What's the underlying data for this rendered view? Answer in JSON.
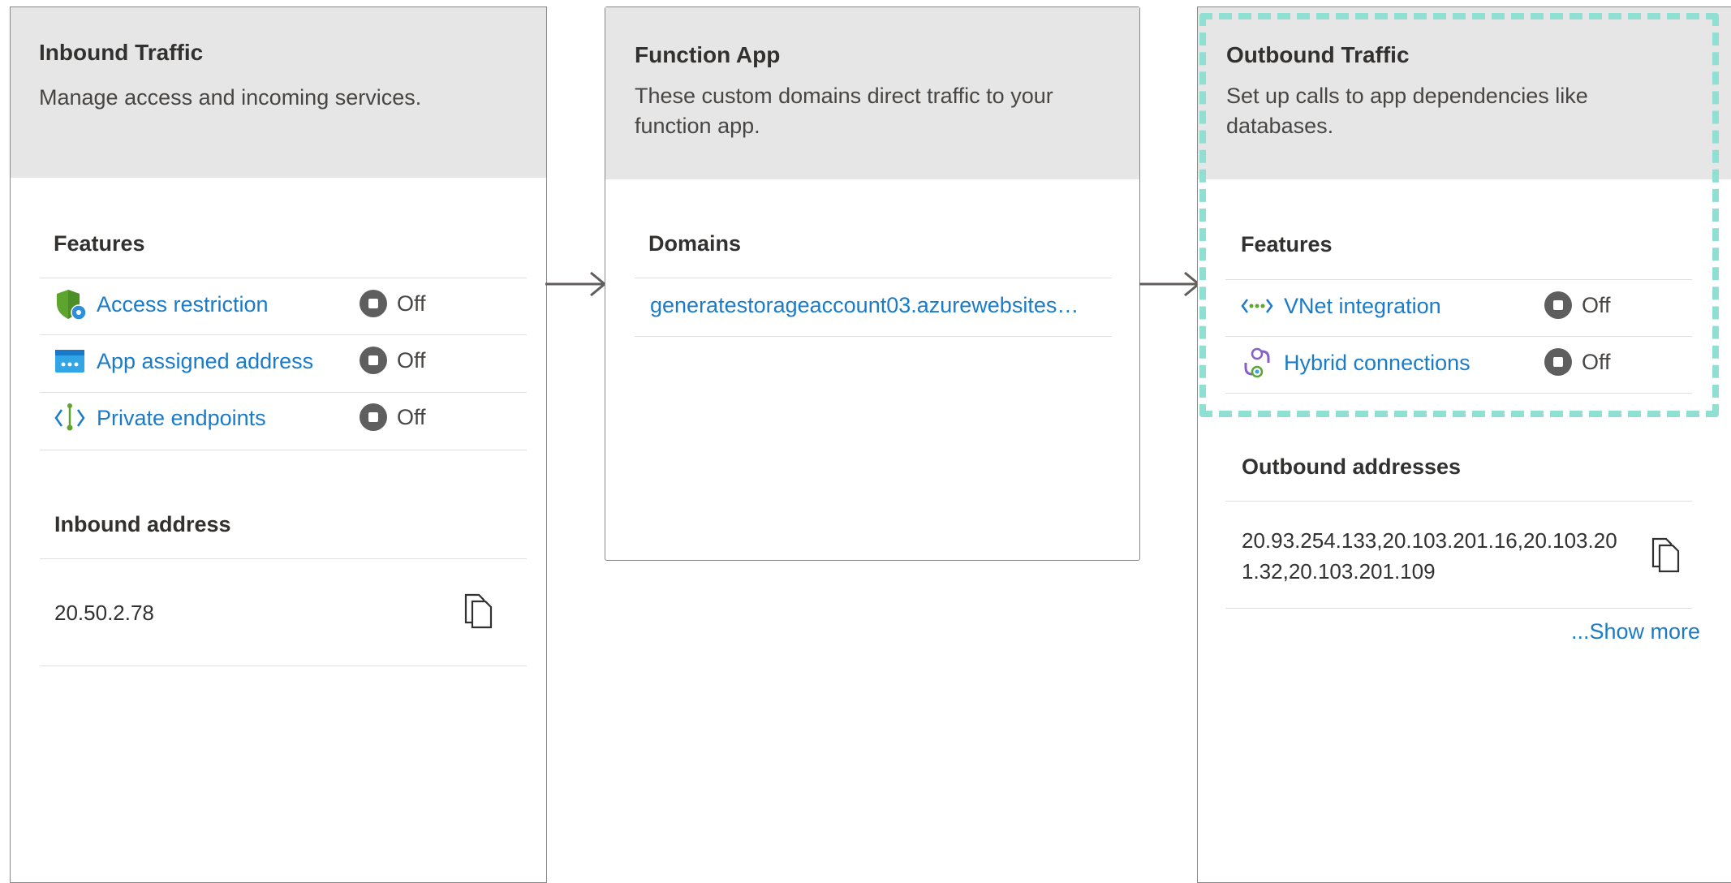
{
  "inbound": {
    "title": "Inbound Traffic",
    "description": "Manage access and incoming services.",
    "features_heading": "Features",
    "features": [
      {
        "label": "Access restriction",
        "icon": "shield-icon",
        "status": "Off"
      },
      {
        "label": "App assigned address",
        "icon": "app-address-icon",
        "status": "Off"
      },
      {
        "label": "Private endpoints",
        "icon": "private-endpoint-icon",
        "status": "Off"
      }
    ],
    "address_heading": "Inbound address",
    "address": "20.50.2.78"
  },
  "function_app": {
    "title": "Function App",
    "description": "These custom domains direct traffic to your function app.",
    "domains_heading": "Domains",
    "domain": "generatestorageaccount03.azurewebsites…"
  },
  "outbound": {
    "title": "Outbound Traffic",
    "description": "Set up calls to app dependencies like databases.",
    "features_heading": "Features",
    "features": [
      {
        "label": "VNet integration",
        "icon": "vnet-icon",
        "status": "Off"
      },
      {
        "label": "Hybrid connections",
        "icon": "hybrid-connection-icon",
        "status": "Off"
      }
    ],
    "addresses_heading": "Outbound addresses",
    "addresses": "20.93.254.133,20.103.201.16,20.103.201.32,20.103.201.109",
    "show_more": "...Show more"
  },
  "colors": {
    "link": "#1a7cc9",
    "header_bg": "#e6e6e6",
    "highlight": "#8fdfd3",
    "status_dot": "#5e5e5e"
  }
}
